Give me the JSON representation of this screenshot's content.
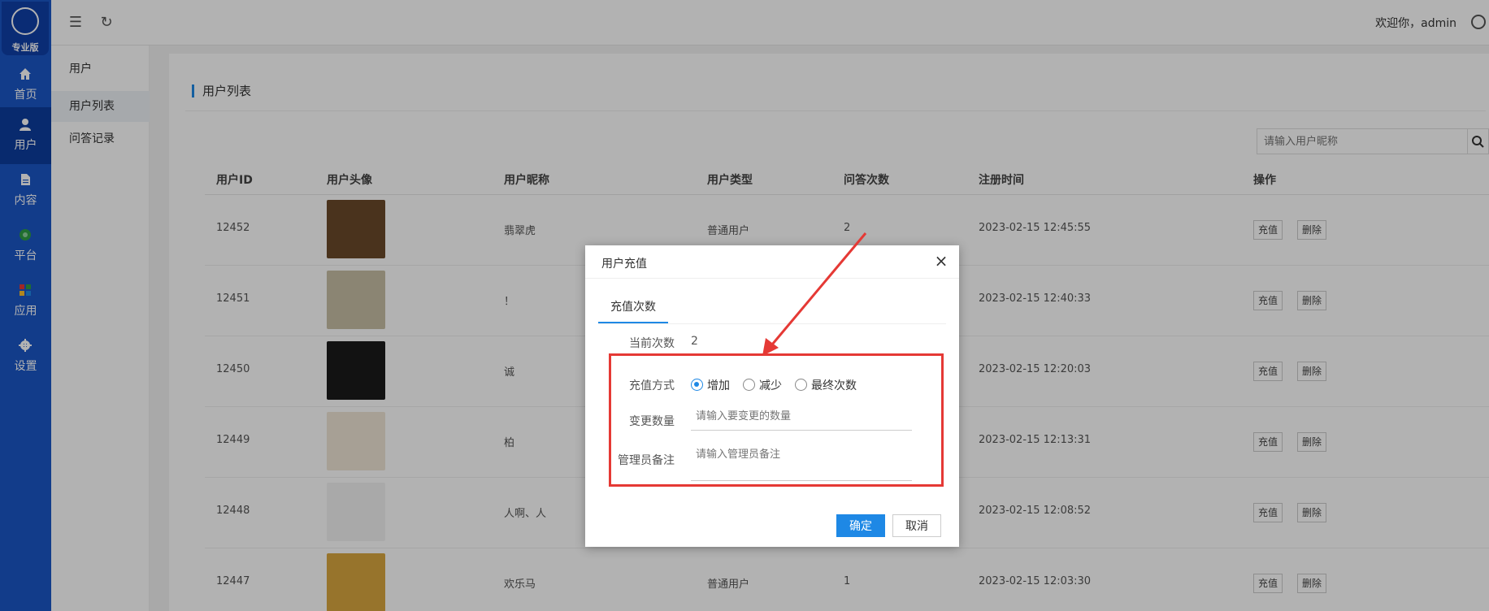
{
  "rail": {
    "logo_text": "专业版",
    "items": [
      {
        "label": "首页",
        "icon": "home-icon"
      },
      {
        "label": "用户",
        "icon": "user-icon"
      },
      {
        "label": "内容",
        "icon": "document-icon"
      },
      {
        "label": "平台",
        "icon": "platform-icon"
      },
      {
        "label": "应用",
        "icon": "apps-icon"
      },
      {
        "label": "设置",
        "icon": "gear-icon"
      }
    ]
  },
  "topbar": {
    "welcome": "欢迎你，admin"
  },
  "subnav": {
    "header": "用户",
    "items": [
      {
        "label": "用户列表"
      },
      {
        "label": "问答记录"
      }
    ]
  },
  "page": {
    "title": "用户列表",
    "search_placeholder": "请输入用户昵称"
  },
  "table": {
    "columns": [
      "用户ID",
      "用户头像",
      "用户昵称",
      "用户类型",
      "问答次数",
      "注册时间",
      "操作"
    ],
    "rows": [
      {
        "id": "12452",
        "nickname": "翡翠虎",
        "type": "普通用户",
        "count": "2",
        "time": "2023-02-15 12:45:55"
      },
      {
        "id": "12451",
        "nickname": "！",
        "type": "",
        "count": "",
        "time": "2023-02-15 12:40:33"
      },
      {
        "id": "12450",
        "nickname": "诚",
        "type": "",
        "count": "",
        "time": "2023-02-15 12:20:03"
      },
      {
        "id": "12449",
        "nickname": "柏",
        "type": "",
        "count": "",
        "time": "2023-02-15 12:13:31"
      },
      {
        "id": "12448",
        "nickname": "人啊、人",
        "type": "",
        "count": "",
        "time": "2023-02-15 12:08:52"
      },
      {
        "id": "12447",
        "nickname": "欢乐马",
        "type": "普通用户",
        "count": "1",
        "time": "2023-02-15 12:03:30"
      }
    ],
    "recharge_label": "充值",
    "delete_label": "删除"
  },
  "dialog": {
    "title": "用户充值",
    "tab": "充值次数",
    "current_label": "当前次数",
    "current_value": "2",
    "method_label": "充值方式",
    "options": [
      "增加",
      "减少",
      "最终次数"
    ],
    "selected_option": "增加",
    "amount_label": "变更数量",
    "amount_placeholder": "请输入要变更的数量",
    "note_label": "管理员备注",
    "note_placeholder": "请输入管理员备注",
    "ok_label": "确定",
    "cancel_label": "取消"
  },
  "colors": {
    "rail": "#1a56c6",
    "accent": "#1e88e5",
    "highlight": "#e53935"
  }
}
